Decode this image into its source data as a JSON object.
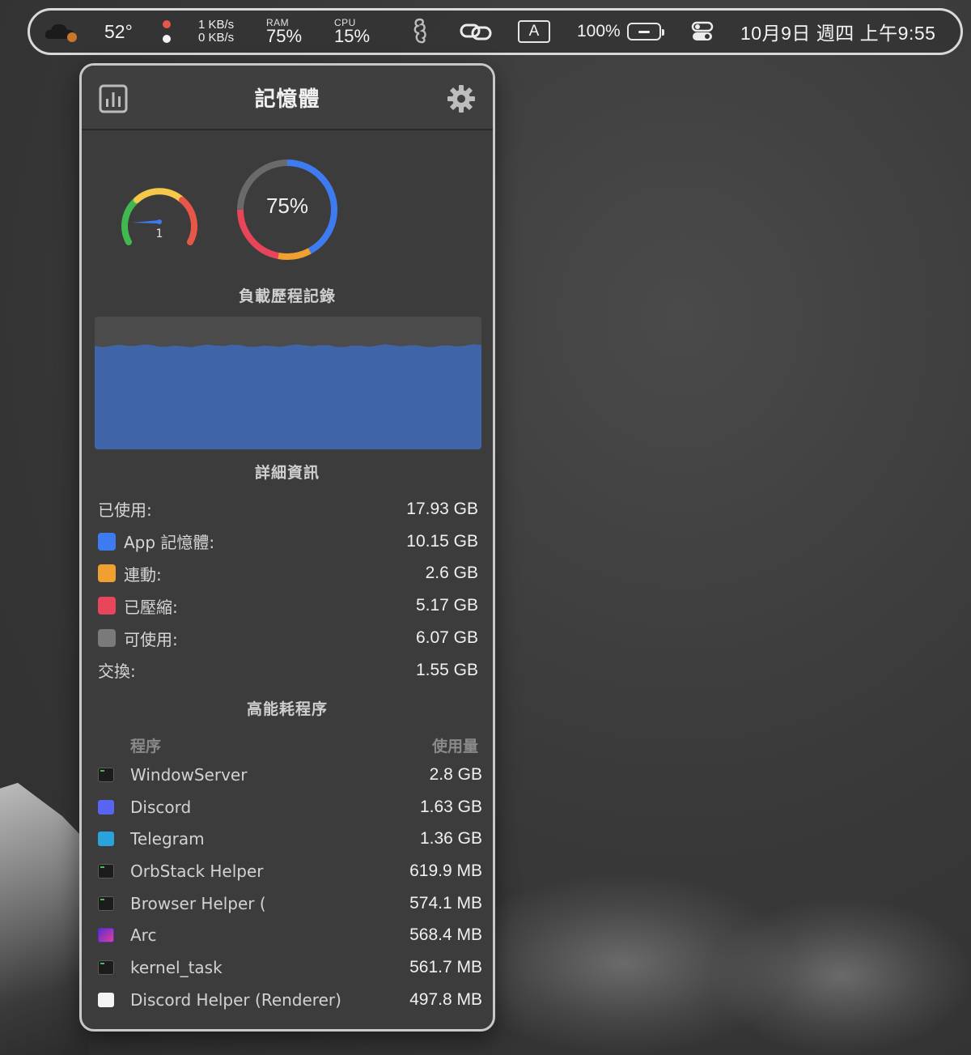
{
  "menubar": {
    "temperature": "52°",
    "net_up": "1 KB/s",
    "net_down": "0 KB/s",
    "ram_label": "RAM",
    "ram_value": "75%",
    "cpu_label": "CPU",
    "cpu_value": "15%",
    "input_source": "A",
    "battery_percent": "100%",
    "datetime": "10月9日 週四 上午9:55",
    "icons": [
      "cloud-weather-icon",
      "status-dots-icon",
      "seahorse-icon",
      "link-icon",
      "keyboard-input-icon",
      "battery-icon",
      "control-center-icon"
    ]
  },
  "panel": {
    "title": "記憶體",
    "load_gauge_value": "1",
    "memory_percent": "75%",
    "memory_ring": {
      "segments": [
        {
          "name": "app",
          "fraction": 0.42,
          "color": "#3f7bf0"
        },
        {
          "name": "wired",
          "fraction": 0.11,
          "color": "#f0a030"
        },
        {
          "name": "compressed",
          "fraction": 0.22,
          "color": "#e8445a"
        },
        {
          "name": "free",
          "fraction": 0.25,
          "color": "#6a6a6a"
        }
      ]
    },
    "history_title": "負載歷程記錄",
    "history_fill_fraction": 0.78,
    "history_color": "#3f64a8",
    "details_title": "詳細資訊",
    "details": [
      {
        "label": "已使用:",
        "value": "17.93 GB",
        "swatch": ""
      },
      {
        "label": "App 記憶體:",
        "value": "10.15 GB",
        "swatch": "#3f7bf0"
      },
      {
        "label": "連動:",
        "value": "2.6 GB",
        "swatch": "#f0a030"
      },
      {
        "label": "已壓縮:",
        "value": "5.17 GB",
        "swatch": "#e8445a"
      },
      {
        "label": "可使用:",
        "value": "6.07 GB",
        "swatch": "#7a7a7a"
      },
      {
        "label": "交換:",
        "value": "1.55 GB",
        "swatch": ""
      }
    ],
    "top_title": "高能耗程序",
    "proc_header": {
      "name": "程序",
      "usage": "使用量"
    },
    "processes": [
      {
        "name": "WindowServer",
        "value": "2.8 GB",
        "icon": "term"
      },
      {
        "name": "Discord",
        "value": "1.63 GB",
        "icon": "discord"
      },
      {
        "name": "Telegram",
        "value": "1.36 GB",
        "icon": "telegram"
      },
      {
        "name": "OrbStack Helper",
        "value": "619.9 MB",
        "icon": "term"
      },
      {
        "name": "Browser Helper (",
        "value": "574.1 MB",
        "icon": "term"
      },
      {
        "name": "Arc",
        "value": "568.4 MB",
        "icon": "arc"
      },
      {
        "name": "kernel_task",
        "value": "561.7 MB",
        "icon": "term"
      },
      {
        "name": "Discord Helper (Renderer)",
        "value": "497.8 MB",
        "icon": "plain"
      }
    ]
  }
}
